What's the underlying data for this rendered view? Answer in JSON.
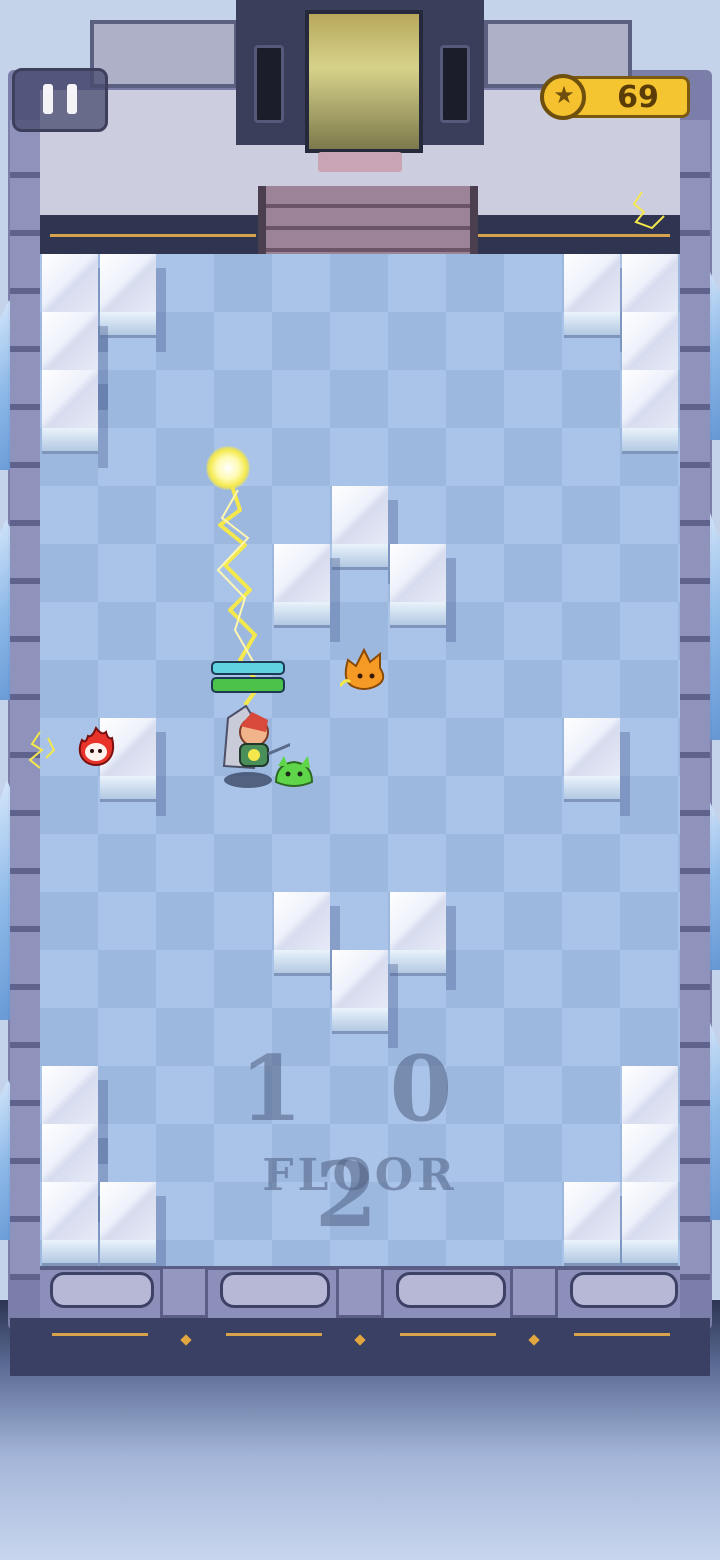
{
  "hud": {
    "pause_icon": "pause-icon",
    "coins": "69",
    "coin_icon": "star-coin-icon"
  },
  "level": {
    "floor_number": "1 0 2",
    "floor_label": "FLOOR"
  },
  "hero": {
    "shield_fill": 1.0,
    "health_fill": 1.0
  },
  "colors": {
    "shield_bar": "#5fd3e0",
    "health_bar": "#4cc24a",
    "coin_bar": "#f5c431",
    "floor_tile_light": "#a9c4e8",
    "floor_tile_dark": "#9cb8df",
    "lightning": "#f4e84c"
  }
}
